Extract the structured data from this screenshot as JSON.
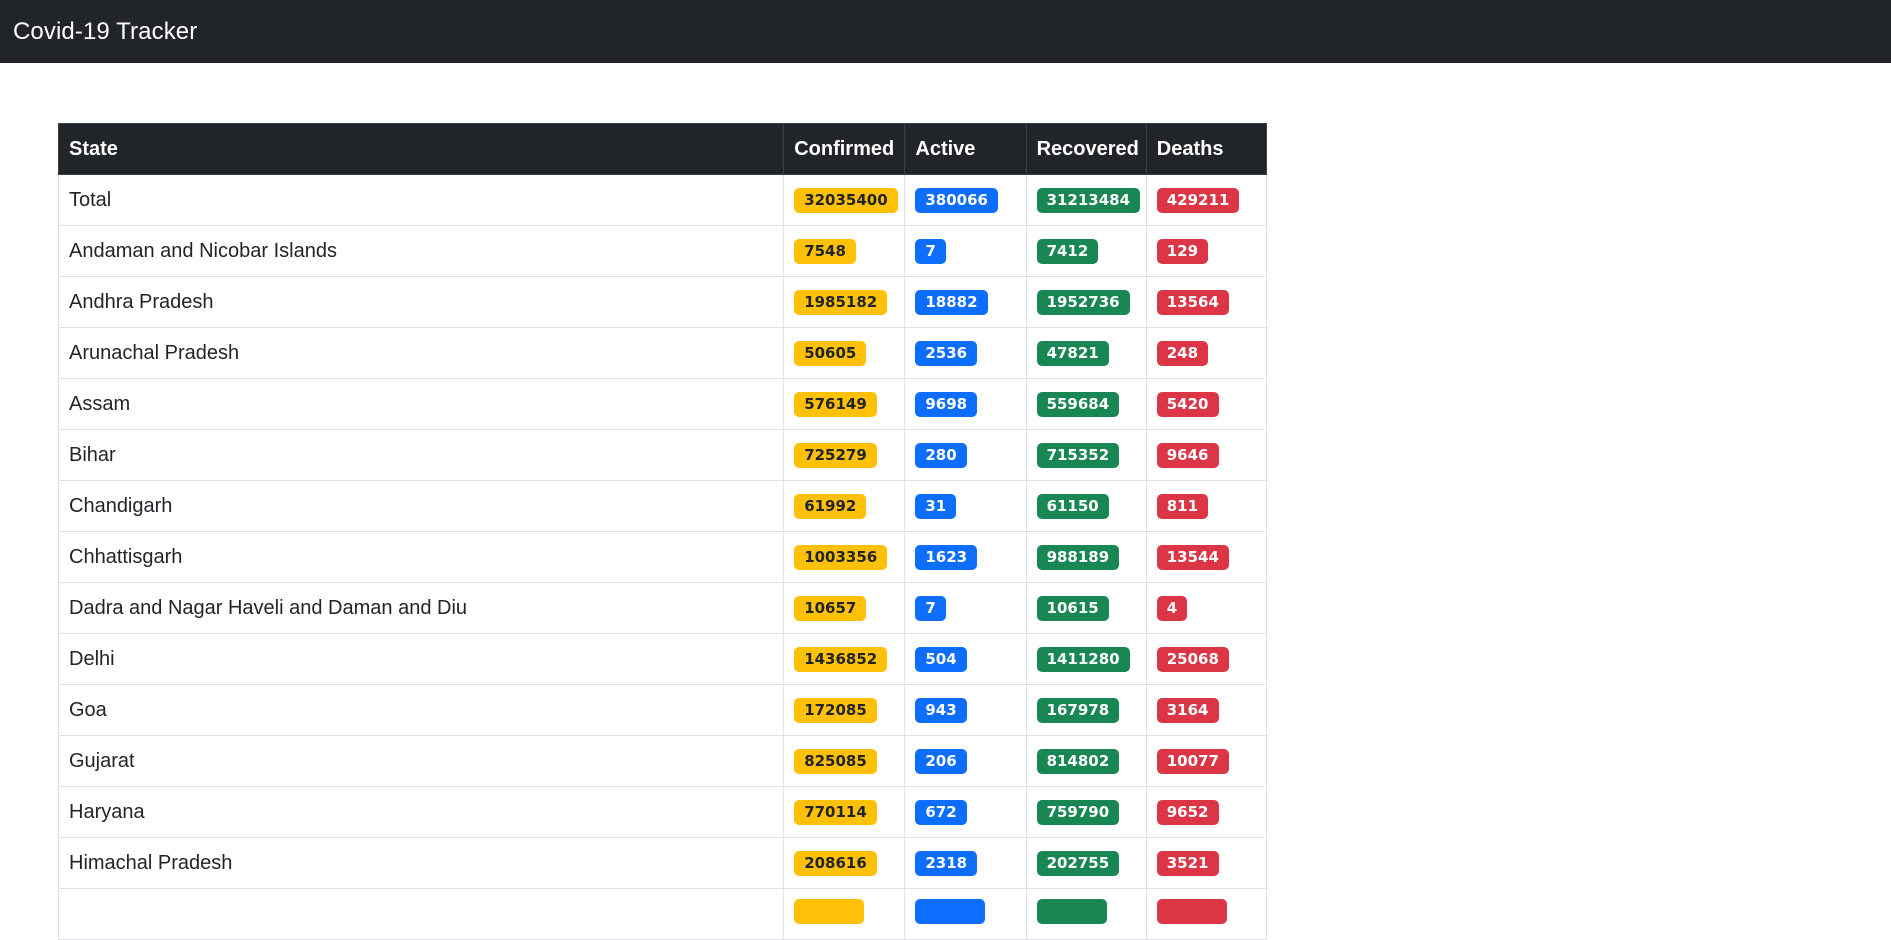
{
  "navbar": {
    "brand": "Covid-19 Tracker"
  },
  "table": {
    "headers": [
      "State",
      "Confirmed",
      "Active",
      "Recovered",
      "Deaths"
    ],
    "rows": [
      {
        "state": "Total",
        "confirmed": "32035400",
        "active": "380066",
        "recovered": "31213484",
        "deaths": "429211"
      },
      {
        "state": "Andaman and Nicobar Islands",
        "confirmed": "7548",
        "active": "7",
        "recovered": "7412",
        "deaths": "129"
      },
      {
        "state": "Andhra Pradesh",
        "confirmed": "1985182",
        "active": "18882",
        "recovered": "1952736",
        "deaths": "13564"
      },
      {
        "state": "Arunachal Pradesh",
        "confirmed": "50605",
        "active": "2536",
        "recovered": "47821",
        "deaths": "248"
      },
      {
        "state": "Assam",
        "confirmed": "576149",
        "active": "9698",
        "recovered": "559684",
        "deaths": "5420"
      },
      {
        "state": "Bihar",
        "confirmed": "725279",
        "active": "280",
        "recovered": "715352",
        "deaths": "9646"
      },
      {
        "state": "Chandigarh",
        "confirmed": "61992",
        "active": "31",
        "recovered": "61150",
        "deaths": "811"
      },
      {
        "state": "Chhattisgarh",
        "confirmed": "1003356",
        "active": "1623",
        "recovered": "988189",
        "deaths": "13544"
      },
      {
        "state": "Dadra and Nagar Haveli and Daman and Diu",
        "confirmed": "10657",
        "active": "7",
        "recovered": "10615",
        "deaths": "4"
      },
      {
        "state": "Delhi",
        "confirmed": "1436852",
        "active": "504",
        "recovered": "1411280",
        "deaths": "25068"
      },
      {
        "state": "Goa",
        "confirmed": "172085",
        "active": "943",
        "recovered": "167978",
        "deaths": "3164"
      },
      {
        "state": "Gujarat",
        "confirmed": "825085",
        "active": "206",
        "recovered": "814802",
        "deaths": "10077"
      },
      {
        "state": "Haryana",
        "confirmed": "770114",
        "active": "672",
        "recovered": "759790",
        "deaths": "9652"
      },
      {
        "state": "Himachal Pradesh",
        "confirmed": "208616",
        "active": "2318",
        "recovered": "202755",
        "deaths": "3521"
      },
      {
        "state": "",
        "confirmed": "",
        "active": "",
        "recovered": "",
        "deaths": ""
      }
    ]
  },
  "colors": {
    "confirmed": "#ffc107",
    "active": "#0d6efd",
    "recovered": "#198754",
    "deaths": "#dc3545",
    "dark": "#212529"
  }
}
